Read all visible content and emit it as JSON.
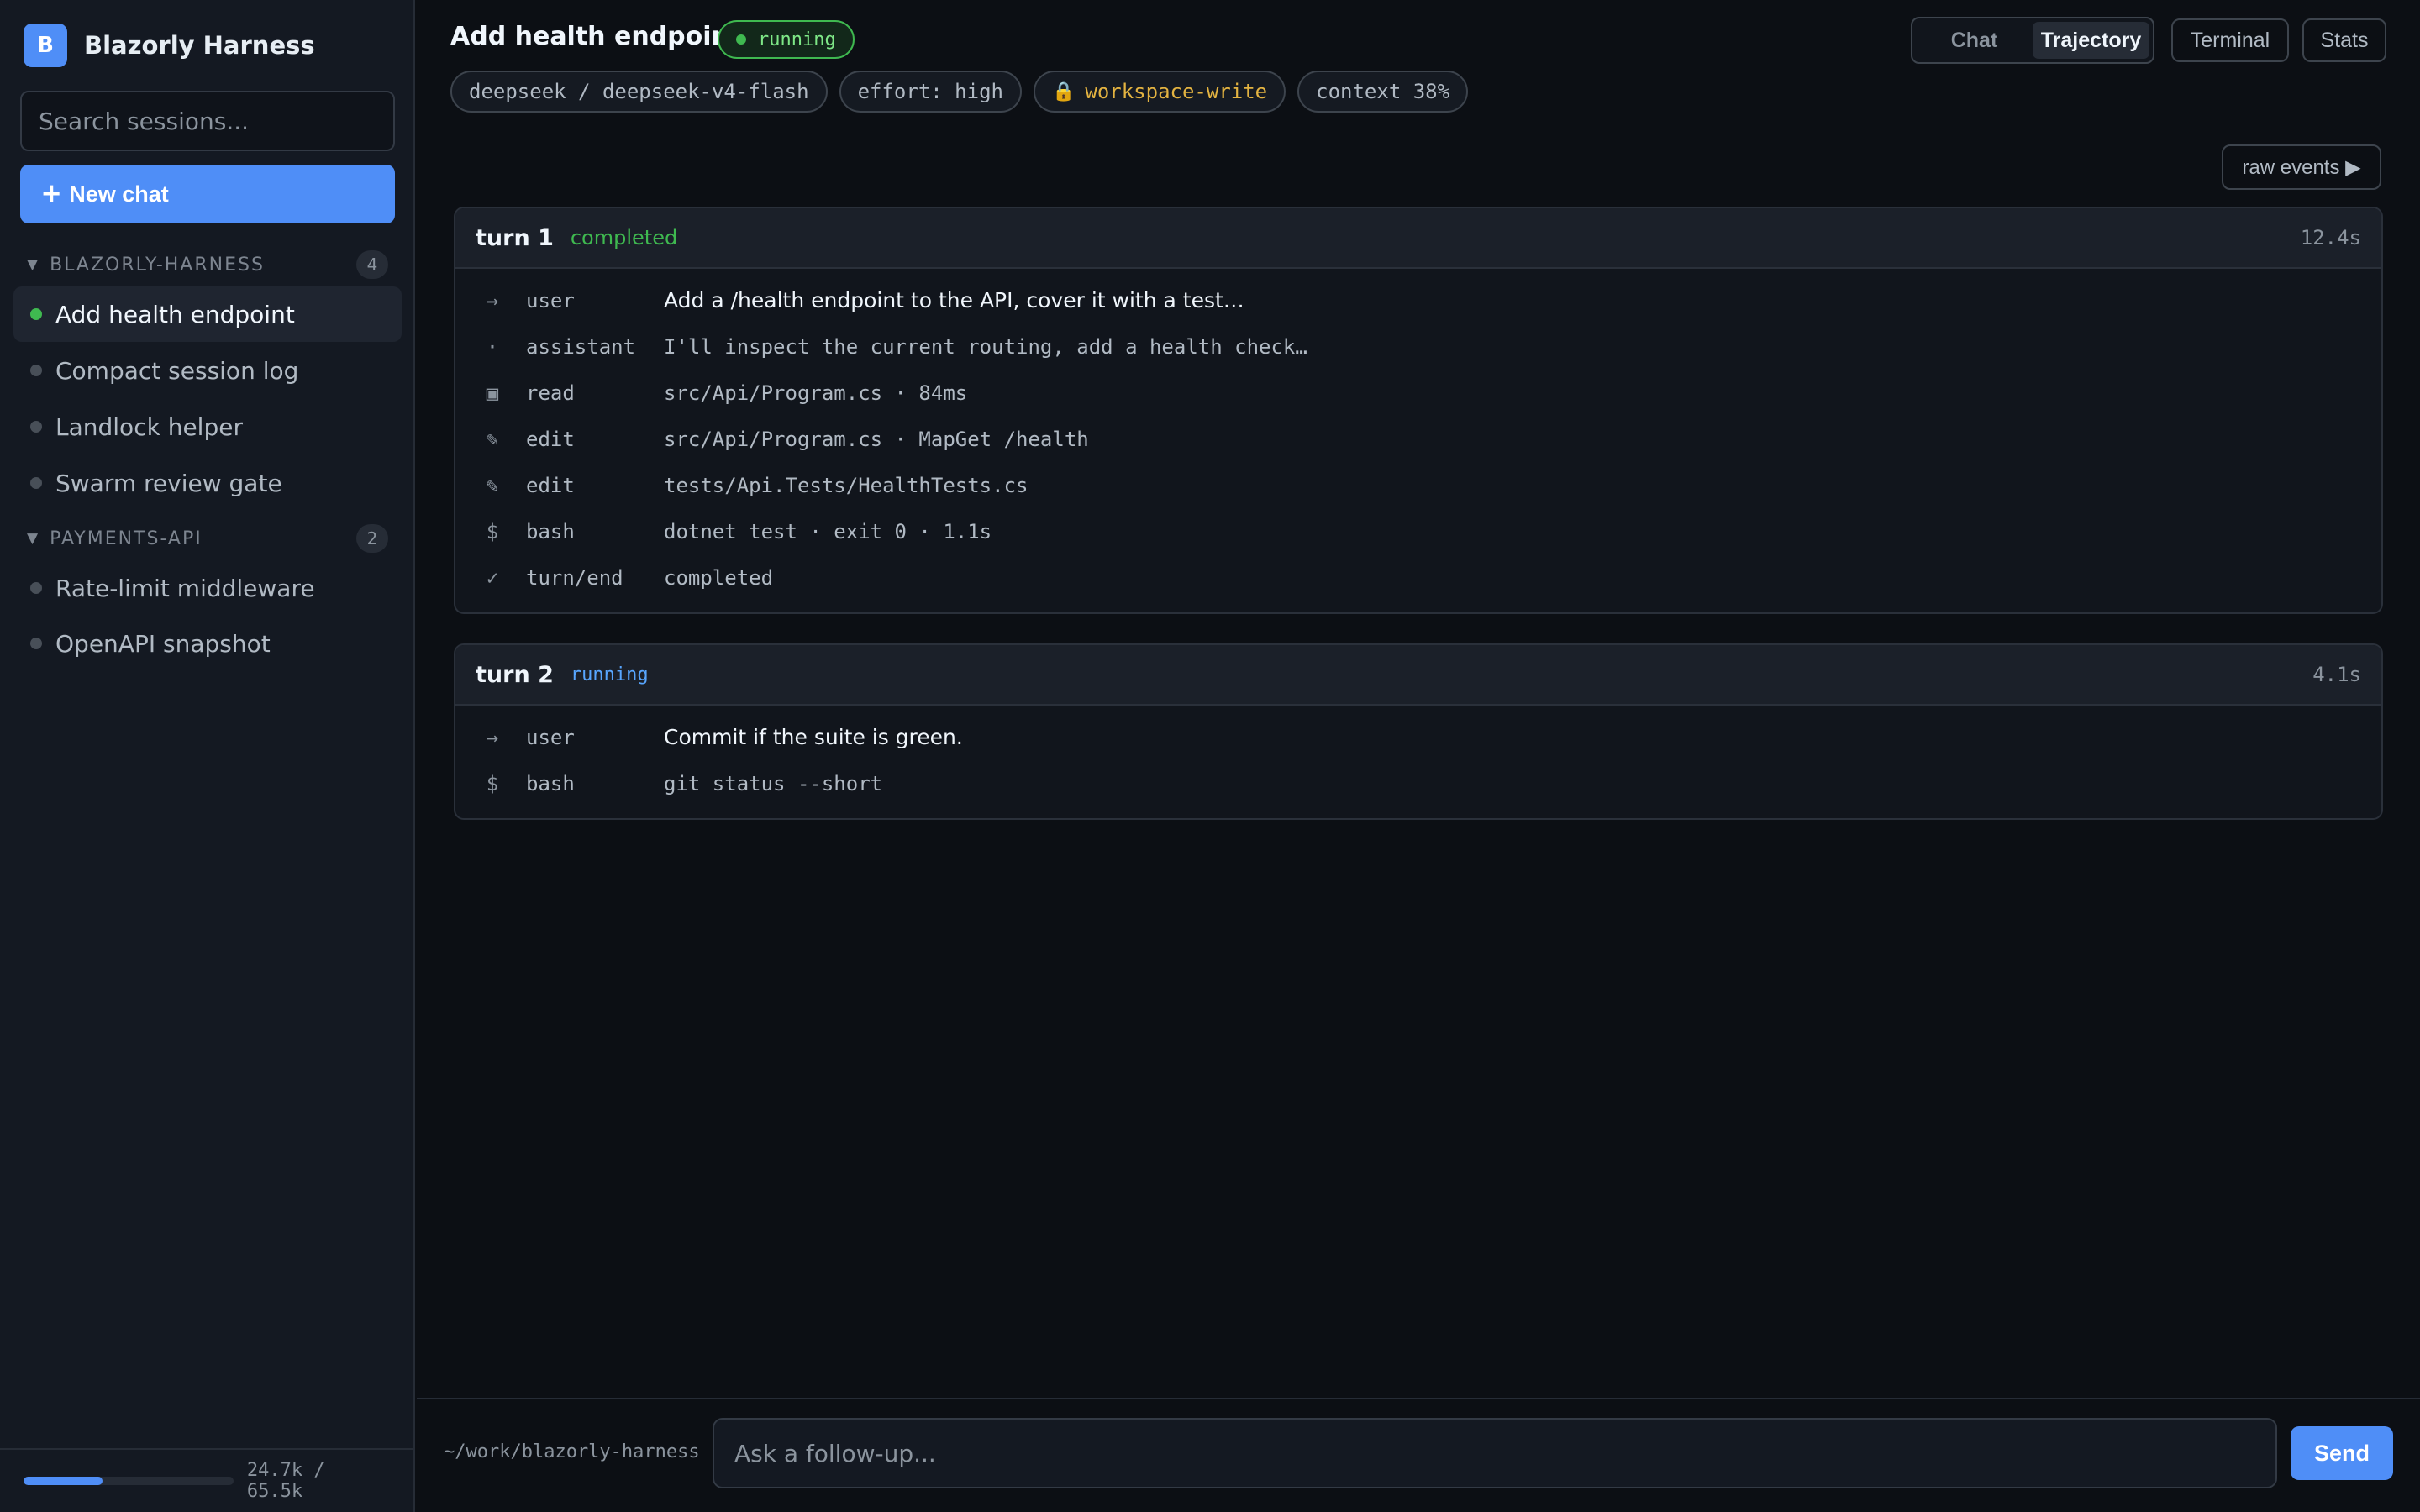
{
  "brand": {
    "initial": "B",
    "name": "Blazorly Harness"
  },
  "search": {
    "placeholder": "Search sessions..."
  },
  "new_chat": {
    "icon": "plus-icon",
    "label": "New chat"
  },
  "groups": [
    {
      "name": "BLAZORLY-HARNESS",
      "count": "4",
      "sessions": [
        {
          "name": "Add health endpoint",
          "active": true
        },
        {
          "name": "Compact session log",
          "active": false
        },
        {
          "name": "Landlock helper",
          "active": false
        },
        {
          "name": "Swarm review gate",
          "active": false
        }
      ]
    },
    {
      "name": "PAYMENTS-API",
      "count": "2",
      "sessions": [
        {
          "name": "Rate-limit middleware",
          "active": false
        },
        {
          "name": "OpenAPI snapshot",
          "active": false
        }
      ]
    }
  ],
  "usage": {
    "text": "24.7k / 65.5k",
    "fraction": 0.377
  },
  "header": {
    "title": "Add health endpoint",
    "status": "running",
    "chips": {
      "model": "deepseek / deepseek-v4-flash",
      "effort": "effort: high",
      "sandbox": "workspace-write",
      "sandbox_icon": "lock-icon",
      "context": "context 38%"
    },
    "views": {
      "chat": "Chat",
      "trajectory": "Trajectory",
      "active": "Trajectory"
    },
    "terminal": "Terminal",
    "stats": "Stats",
    "raw_events": "raw events ▶"
  },
  "turns": [
    {
      "name": "turn 1",
      "status": "completed",
      "time": "12.4s",
      "events": [
        {
          "icon": "→",
          "type": "user",
          "text": "Add a /health endpoint to the API, cover it with a test…",
          "prose": true
        },
        {
          "icon": "·",
          "type": "assistant",
          "text": "I'll inspect the current routing, add a health check…",
          "prose": false
        },
        {
          "icon": "▣",
          "type": "read",
          "text": "src/Api/Program.cs · 84ms",
          "prose": false
        },
        {
          "icon": "✎",
          "type": "edit",
          "text": "src/Api/Program.cs · MapGet /health",
          "prose": false
        },
        {
          "icon": "✎",
          "type": "edit",
          "text": "tests/Api.Tests/HealthTests.cs",
          "prose": false
        },
        {
          "icon": "$",
          "type": "bash",
          "text": "dotnet test · exit 0 · 1.1s",
          "prose": false
        },
        {
          "icon": "✓",
          "type": "turn/end",
          "text": "completed",
          "prose": false
        }
      ]
    },
    {
      "name": "turn 2",
      "status": "running",
      "time": "4.1s",
      "events": [
        {
          "icon": "→",
          "type": "user",
          "text": "Commit if the suite is green.",
          "prose": true
        },
        {
          "icon": "$",
          "type": "bash",
          "text": "git status --short",
          "prose": false
        }
      ]
    }
  ],
  "composer": {
    "cwd": "~/work/blazorly-harness",
    "placeholder": "Ask a follow-up...",
    "send": "Send"
  }
}
